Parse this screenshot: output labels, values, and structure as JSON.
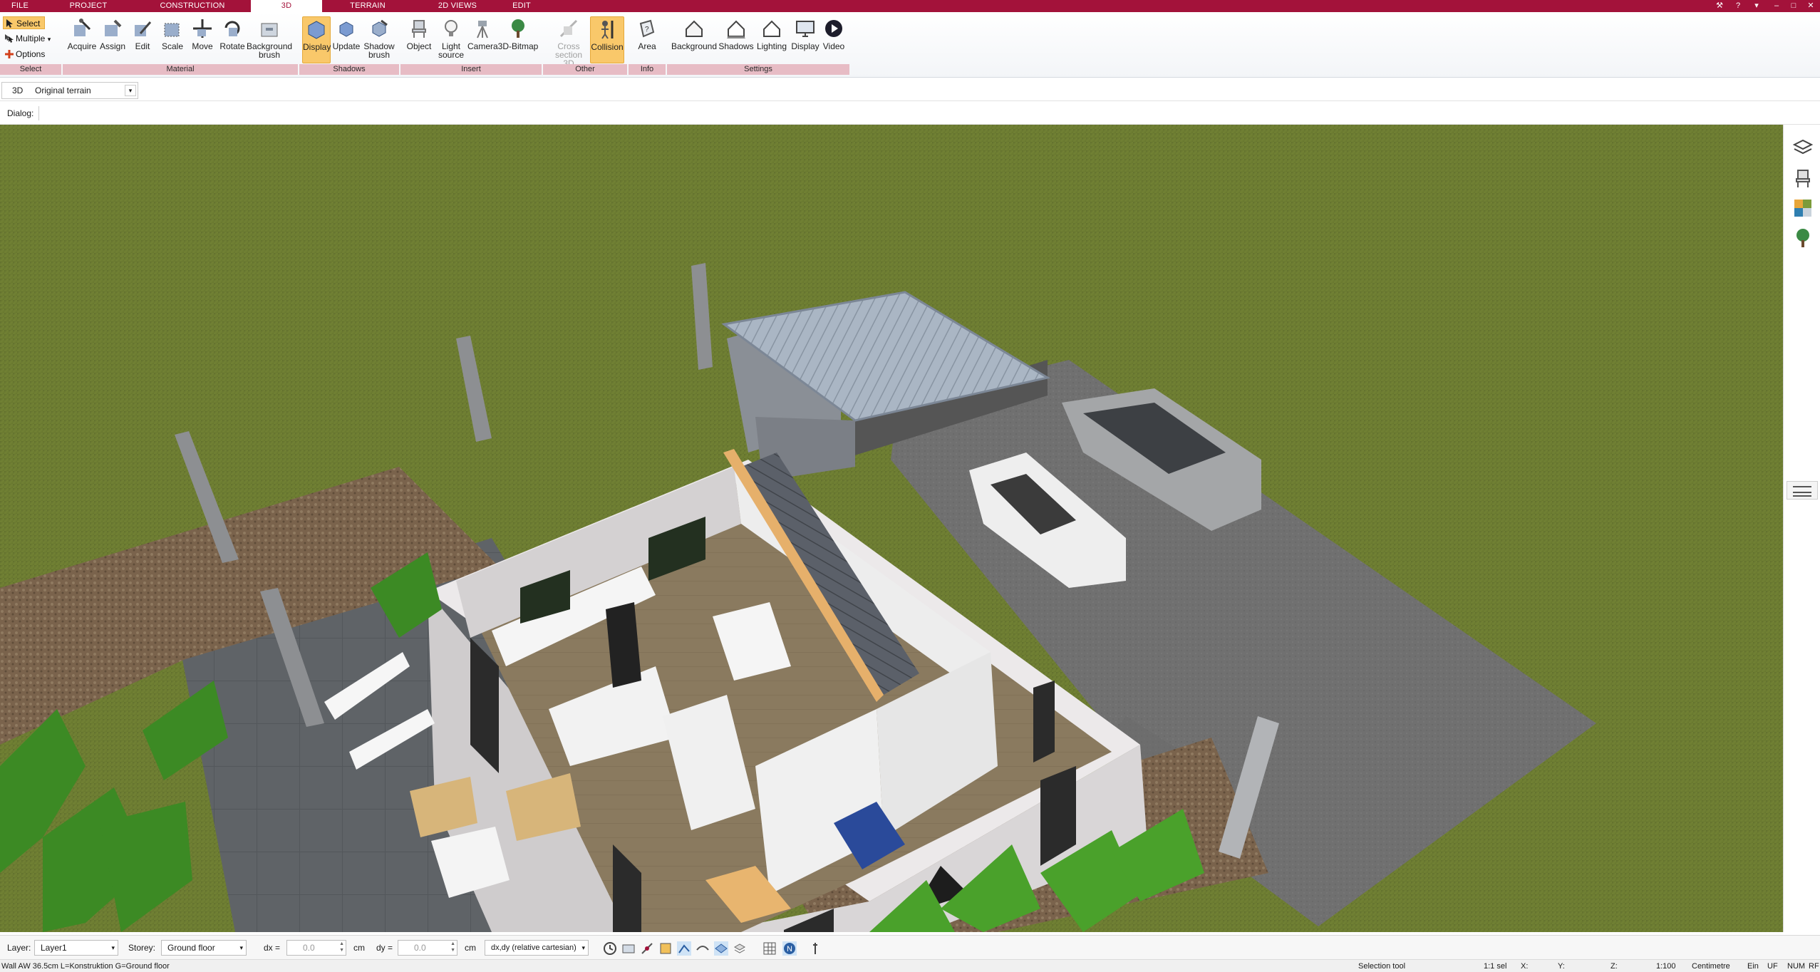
{
  "tabs": [
    {
      "label": "FILE"
    },
    {
      "label": "PROJECT"
    },
    {
      "label": "CONSTRUCTION"
    },
    {
      "label": "3D",
      "active": true
    },
    {
      "label": "TERRAIN"
    },
    {
      "label": "2D VIEWS"
    },
    {
      "label": "EDIT"
    }
  ],
  "select_group": {
    "items": [
      {
        "label": "Select",
        "active": true
      },
      {
        "label": "Multiple"
      },
      {
        "label": "Options"
      }
    ],
    "name": "Select"
  },
  "ribbon": {
    "buttons": [
      {
        "label": "Acquire"
      },
      {
        "label": "Assign"
      },
      {
        "label": "Edit"
      },
      {
        "label": "Scale"
      },
      {
        "label": "Move"
      },
      {
        "label": "Rotate"
      },
      {
        "label": "Background brush"
      },
      {
        "label": "Display",
        "active": true
      },
      {
        "label": "Update"
      },
      {
        "label": "Shadow brush"
      },
      {
        "label": "Object"
      },
      {
        "label": "Light source"
      },
      {
        "label": "Camera"
      },
      {
        "label": "3D-Bitmap"
      },
      {
        "label": "Cross section 3D",
        "disabled": true
      },
      {
        "label": "Collision",
        "active": true
      },
      {
        "label": "Area"
      },
      {
        "label": "Background"
      },
      {
        "label": "Shadows"
      },
      {
        "label": "Lighting"
      },
      {
        "label": "Display"
      },
      {
        "label": "Video"
      }
    ],
    "groups": [
      "Select",
      "Material",
      "Shadows",
      "Insert",
      "Other",
      "Info",
      "Settings"
    ]
  },
  "viewbar": {
    "mode": "3D",
    "terrain": "Original terrain"
  },
  "dialog_label": "Dialog:",
  "bottombar": {
    "layer_label": "Layer:",
    "layer_value": "Layer1",
    "storey_label": "Storey:",
    "storey_value": "Ground floor",
    "dx_label": "dx =",
    "dx_value": "0.0",
    "dx_unit": "cm",
    "dy_label": "dy =",
    "dy_value": "0.0",
    "dy_unit": "cm",
    "coord_mode": "dx,dy (relative cartesian)"
  },
  "status": {
    "left": "Wall AW 36.5cm L=Konstruktion G=Ground floor",
    "tool": "Selection tool",
    "sel": "1:1 sel",
    "x": "X:",
    "y": "Y:",
    "z": "Z:",
    "scale": "1:100",
    "unit": "Centimetre",
    "ein": "Ein",
    "uf": "UF",
    "num": "NUM",
    "rf": "RF"
  },
  "colors": {
    "brand": "#a3123a",
    "active": "#f9c86a",
    "group": "#e7bcc5"
  }
}
